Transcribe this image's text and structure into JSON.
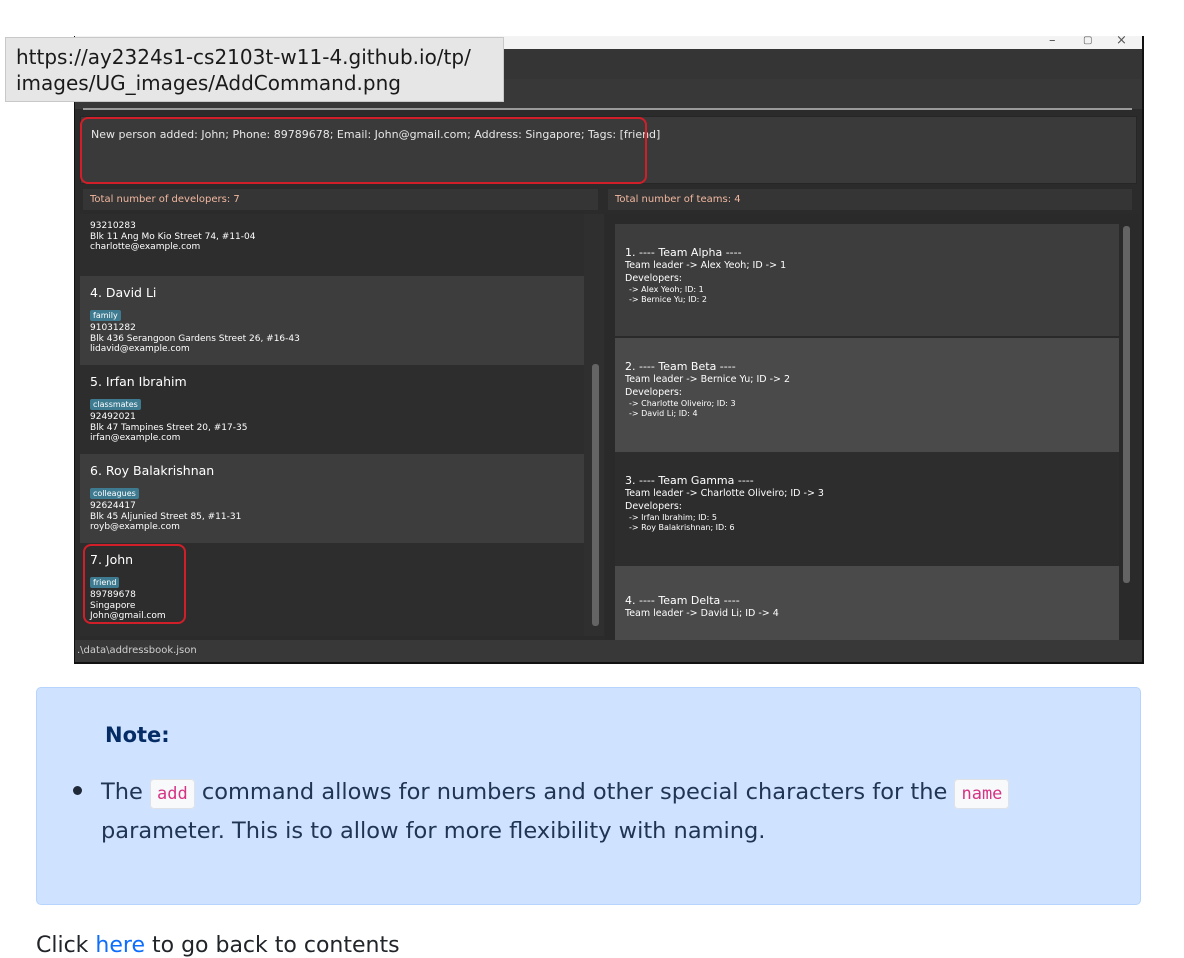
{
  "tooltip": {
    "url_lines": [
      "https://ay2324s1-cs2103t-w11-4.github.io/tp/",
      "images/UG_images/AddCommand.png"
    ]
  },
  "window": {
    "minimize": "–",
    "maximize": "▢",
    "close": "×"
  },
  "result_message": "New person added: John; Phone: 89789678; Email: John@gmail.com; Address: Singapore; Tags: [friend]",
  "developers_header": "Total number of developers: 7",
  "teams_header": "Total number of teams: 4",
  "persons": [
    {
      "index_name": "",
      "tag": "",
      "phone": "93210283",
      "address": "Blk 11 Ang Mo Kio Street 74, #11-04",
      "email": "charlotte@example.com"
    },
    {
      "index_name": "4.  David Li",
      "tag": "family",
      "phone": "91031282",
      "address": "Blk 436 Serangoon Gardens Street 26, #16-43",
      "email": "lidavid@example.com"
    },
    {
      "index_name": "5.  Irfan Ibrahim",
      "tag": "classmates",
      "phone": "92492021",
      "address": "Blk 47 Tampines Street 20, #17-35",
      "email": "irfan@example.com"
    },
    {
      "index_name": "6.  Roy Balakrishnan",
      "tag": "colleagues",
      "phone": "92624417",
      "address": "Blk 45 Aljunied Street 85, #11-31",
      "email": "royb@example.com"
    },
    {
      "index_name": "7.  John",
      "tag": "friend",
      "phone": "89789678",
      "address": "Singapore",
      "email": "John@gmail.com"
    }
  ],
  "teams": [
    {
      "title": "1.    ----  Team Alpha  ----",
      "leader": "Team leader ->  Alex Yeoh;   ID -> 1",
      "dev_label": "Developers:",
      "devs": [
        "->  Alex Yeoh;   ID: 1",
        "->  Bernice Yu;   ID: 2"
      ]
    },
    {
      "title": "2.    ----  Team Beta  ----",
      "leader": "Team leader ->  Bernice Yu;   ID ->  2",
      "dev_label": "Developers:",
      "devs": [
        "->  Charlotte Oliveiro;   ID: 3",
        "->  David Li;   ID: 4"
      ]
    },
    {
      "title": "3.    ----  Team Gamma  ----",
      "leader": "Team leader ->  Charlotte Oliveiro;   ID -> 3",
      "dev_label": "Developers:",
      "devs": [
        "->  Irfan Ibrahim;   ID: 5",
        "->  Roy Balakrishnan;   ID: 6"
      ]
    },
    {
      "title": "4.    ----  Team Delta  ----",
      "leader": "Team leader ->  David Li;   ID -> 4",
      "dev_label": "",
      "devs": []
    }
  ],
  "status_path": ".\\data\\addressbook.json",
  "note": {
    "title": "Note:",
    "text_1": "The ",
    "code_1": "add",
    "text_2": " command allows for numbers and other special characters for the ",
    "code_2": "name",
    "text_3": " parameter. This is to allow for more flexibility with naming."
  },
  "footer": {
    "before": "Click ",
    "link": "here",
    "after": " to go back to contents"
  },
  "colors": {
    "highlight_red": "#d11f2a",
    "note_bg": "#cfe2ff",
    "tag_bg": "#3e7b91",
    "header_text": "#f2b8a0"
  }
}
